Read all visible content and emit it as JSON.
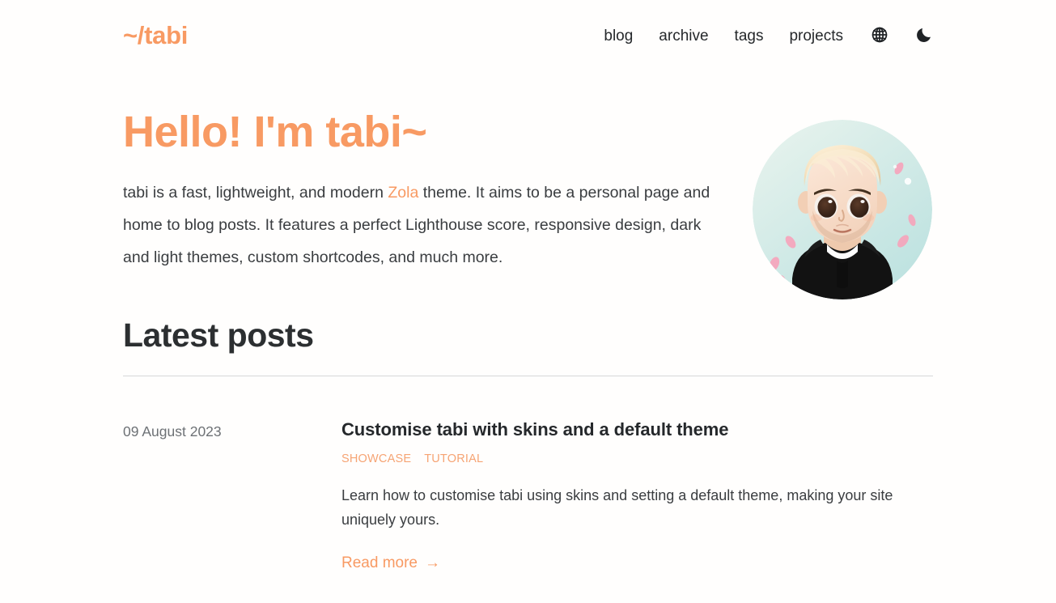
{
  "site": {
    "brand": "~/tabi",
    "accent_color": "#f89a63",
    "background_color": "#fffefd",
    "text_color": "#2b2b2b"
  },
  "nav": {
    "links": [
      {
        "label": "blog"
      },
      {
        "label": "archive"
      },
      {
        "label": "tags"
      },
      {
        "label": "projects"
      }
    ],
    "icons": [
      {
        "name": "globe-icon",
        "label": "globe-icon"
      },
      {
        "name": "moon-icon",
        "label": "moon-icon"
      }
    ]
  },
  "hero": {
    "title": "Hello! I'm tabi~",
    "paragraph_part1": "tabi is a fast, lightweight, and modern ",
    "link_label": "Zola",
    "paragraph_part2": " theme. It aims to be a personal page and home to blog posts. It features a perfect Lighthouse score, responsive design, dark and light themes, custom shortcodes, and much more.",
    "avatar": {
      "name": "avatar-illustration",
      "description": "Cartoon avatar of a blonde person with large dark eyes wearing a black hoodie on a mint gradient circle with pink petals",
      "background_from": "#e4f1ec",
      "background_to": "#bfe3e0",
      "hair_color": "#f5dfc0",
      "skin_color": "#f8ddcb",
      "hoodie_color": "#121212",
      "petal_color": "#f9a8c0"
    }
  },
  "latest_posts": {
    "heading": "Latest posts",
    "posts": [
      {
        "date": "09 August 2023",
        "title": "Customise tabi with skins and a default theme",
        "tags": [
          "SHOWCASE",
          "TUTORIAL"
        ],
        "description": "Learn how to customise tabi using skins and setting a default theme, making your site uniquely yours.",
        "read_more_label": "Read more",
        "read_more_arrow": "→"
      }
    ]
  }
}
